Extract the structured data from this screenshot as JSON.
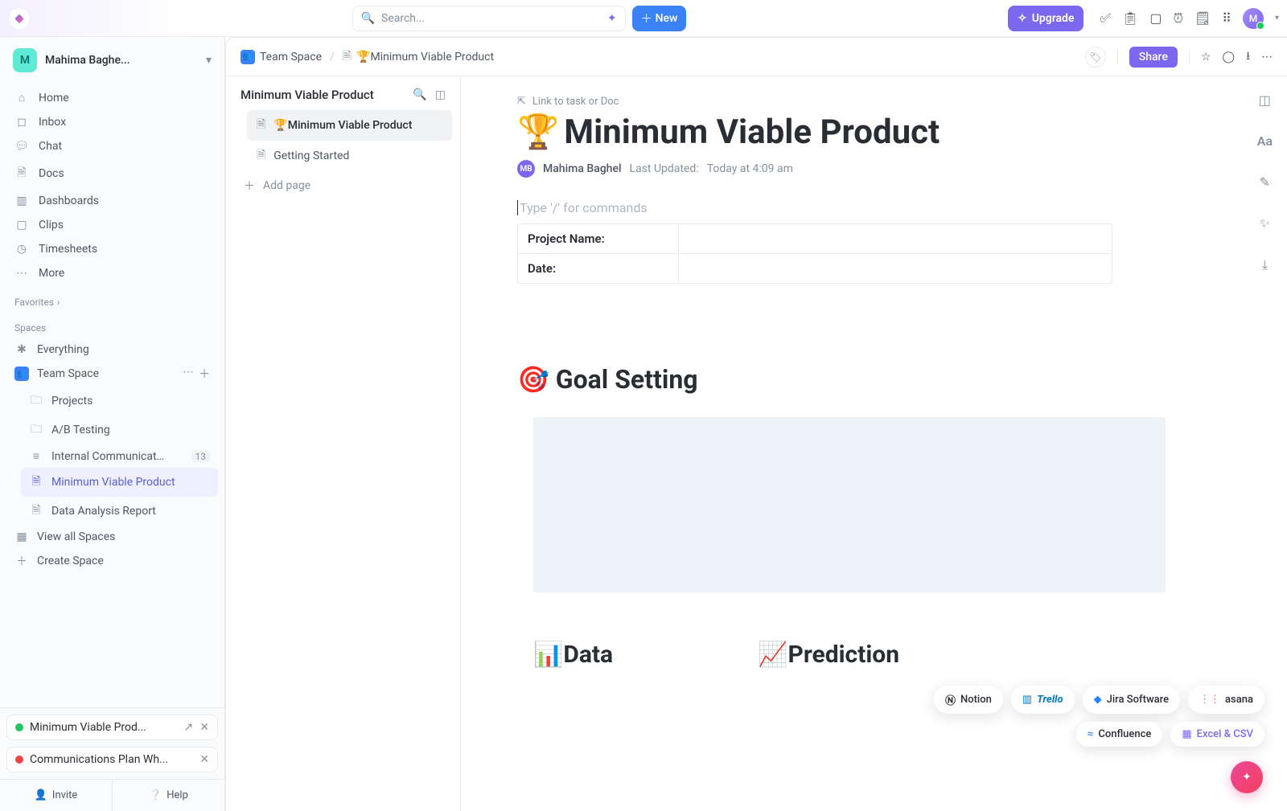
{
  "topbar": {
    "search_placeholder": "Search...",
    "new_label": "New",
    "upgrade_label": "Upgrade",
    "avatar_initial": "M"
  },
  "workspace": {
    "badge": "M",
    "name": "Mahima Baghe..."
  },
  "nav": [
    {
      "icon": "⌂",
      "label": "Home"
    },
    {
      "icon": "inbox",
      "label": "Inbox"
    },
    {
      "icon": "chat",
      "label": "Chat"
    },
    {
      "icon": "doc",
      "label": "Docs"
    },
    {
      "icon": "dash",
      "label": "Dashboards"
    },
    {
      "icon": "clip",
      "label": "Clips"
    },
    {
      "icon": "time",
      "label": "Timesheets"
    },
    {
      "icon": "more",
      "label": "More"
    }
  ],
  "sections": {
    "favorites": "Favorites",
    "spaces": "Spaces"
  },
  "spaces": {
    "everything": {
      "label": "Everything"
    },
    "team": {
      "label": "Team Space"
    },
    "children": [
      {
        "label": "Projects"
      },
      {
        "label": "A/B Testing"
      },
      {
        "label": "Internal Communicati...",
        "badge": "13"
      },
      {
        "label": "Minimum Viable Product",
        "selected": true
      },
      {
        "label": "Data Analysis Report"
      }
    ],
    "view_all": "View all Spaces",
    "create": "Create Space"
  },
  "open_docs": [
    {
      "status": "g",
      "title": "Minimum Viable Prod..."
    },
    {
      "status": "r",
      "title": "Communications Plan Wh..."
    }
  ],
  "footer": {
    "invite": "Invite",
    "help": "Help"
  },
  "breadcrumb": {
    "space": "Team Space",
    "doc": "🏆Minimum Viable Product",
    "share": "Share"
  },
  "outline": {
    "title": "Minimum Viable Product",
    "items": [
      {
        "label": "🏆Minimum Viable Product",
        "selected": true
      },
      {
        "label": "Getting Started"
      }
    ],
    "add": "Add page"
  },
  "doc": {
    "link_to": "Link to task or Doc",
    "emoji": "🏆",
    "title": "Minimum Viable Product",
    "author": "Mahima Baghel",
    "author_initials": "MB",
    "updated_label": "Last Updated:",
    "updated_value": "Today at 4:09 am",
    "slash": "Type '/' for commands",
    "table": [
      {
        "label": "Project Name:",
        "value": ""
      },
      {
        "label": "Date:",
        "value": ""
      }
    ],
    "h_goal": "🎯 Goal Setting",
    "h_data": "📊Data",
    "h_pred": "📈Prediction"
  },
  "rail": {
    "aa": "Aa"
  },
  "integrations": [
    "Notion",
    "Trello",
    "Jira Software",
    "asana",
    "Confluence",
    "Excel & CSV"
  ]
}
